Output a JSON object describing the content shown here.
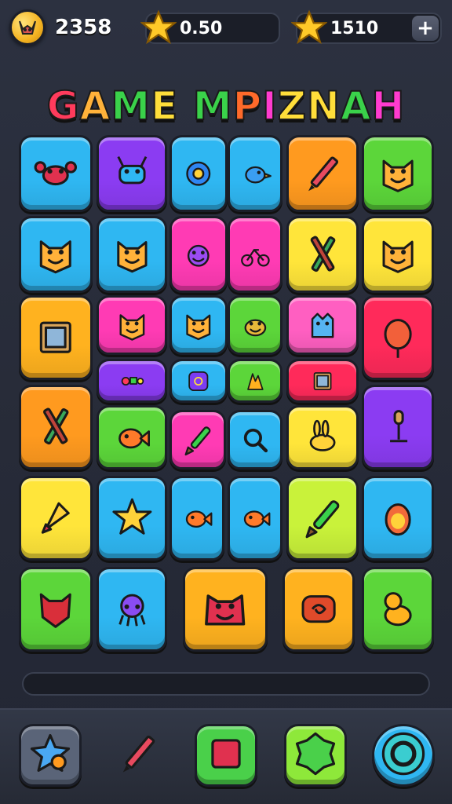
{
  "hud": {
    "score": "2358",
    "currency_1": "0.50",
    "currency_2": "1510",
    "add_label": "+"
  },
  "title": {
    "text": "GAME MPIZNAH",
    "letter_colors": [
      "#ff3b5c",
      "#ffb23a",
      "#3ad24a",
      "#ffde3a",
      "#3ad24a",
      "#ff6a2a",
      "#ff3bcf",
      "#ffde3a",
      "#ffde3a",
      "#3ad24a",
      "#ff3bcf",
      "#ffde3a"
    ]
  },
  "tiles": [
    {
      "icon": "crab-icon",
      "color": "#2fb7f2"
    },
    {
      "icon": "bug-monster-icon",
      "color": "#8b3cf2"
    },
    {
      "icon": "flower-icon",
      "color": "#2fb7f2"
    },
    {
      "icon": "bird-icon",
      "color": "#2fb7f2"
    },
    {
      "icon": "pencil-icon",
      "color": "#ff9a1f"
    },
    {
      "icon": "cat-face-icon",
      "color": "#5cd63a"
    },
    {
      "icon": "spiky-creature-icon",
      "color": "#2fb7f2"
    },
    {
      "icon": "star-face-icon",
      "color": "#2fb7f2"
    },
    {
      "icon": "purple-monster-icon",
      "color": "#ff3bb4"
    },
    {
      "icon": "bicycle-icon",
      "color": "#ff3bb4"
    },
    {
      "icon": "crossed-pencils-icon",
      "color": "#ffe53a"
    },
    {
      "icon": "cat-face-icon",
      "color": "#ffe53a"
    },
    {
      "icon": "frame-icon",
      "color": "#ffb21f"
    },
    {
      "icon": "blob-face-icon",
      "color": "#ff3bb4"
    },
    {
      "icon": "cat-face-icon",
      "color": "#2fb7f2"
    },
    {
      "icon": "frog-icon",
      "color": "#5cd63a"
    },
    {
      "icon": "ghost-cat-icon",
      "color": "#ff5fc1"
    },
    {
      "icon": "balloon-icon",
      "color": "#ff2a5a"
    },
    {
      "icon": "mixed-shapes-icon",
      "color": "#8b3cf2"
    },
    {
      "icon": "swirl-icon",
      "color": "#2fb7f2"
    },
    {
      "icon": "sculpture-icon",
      "color": "#5cd63a"
    },
    {
      "icon": "frame-icon",
      "color": "#ff2a5a"
    },
    {
      "icon": "crossed-sticks-icon",
      "color": "#ff9a1f"
    },
    {
      "icon": "fish-icon",
      "color": "#5cd63a"
    },
    {
      "icon": "paintbrush-icon",
      "color": "#ff3bb4"
    },
    {
      "icon": "magnifier-icon",
      "color": "#2fb7f2"
    },
    {
      "icon": "bunny-icon",
      "color": "#ffe53a"
    },
    {
      "icon": "microphone-icon",
      "color": "#8b3cf2"
    },
    {
      "icon": "rocket-icon",
      "color": "#ffe53a"
    },
    {
      "icon": "star-icon",
      "color": "#2fb7f2"
    },
    {
      "icon": "fish-icon",
      "color": "#2fb7f2"
    },
    {
      "icon": "fish-icon",
      "color": "#2fb7f2"
    },
    {
      "icon": "paintbrush-icon",
      "color": "#c9f23a"
    },
    {
      "icon": "egg-icon",
      "color": "#2fb7f2"
    },
    {
      "icon": "demon-mask-icon",
      "color": "#5cd63a"
    },
    {
      "icon": "octopus-icon",
      "color": "#2fb7f2"
    },
    {
      "icon": "red-monster-icon",
      "color": "#ffb21f"
    },
    {
      "icon": "snail-icon",
      "color": "#ffb21f"
    },
    {
      "icon": "cat-icon",
      "color": "#5cd63a"
    }
  ],
  "progress": {
    "value": 0.0
  },
  "toolbar": [
    {
      "icon": "star-shape-icon",
      "color": "#5a6478"
    },
    {
      "icon": "pencil-icon",
      "color": "none"
    },
    {
      "icon": "red-square-icon",
      "color": "#4ad04a"
    },
    {
      "icon": "green-gem-icon",
      "color": "#8ee83a"
    },
    {
      "icon": "target-ring-icon",
      "color": "#2fb7f2"
    }
  ]
}
